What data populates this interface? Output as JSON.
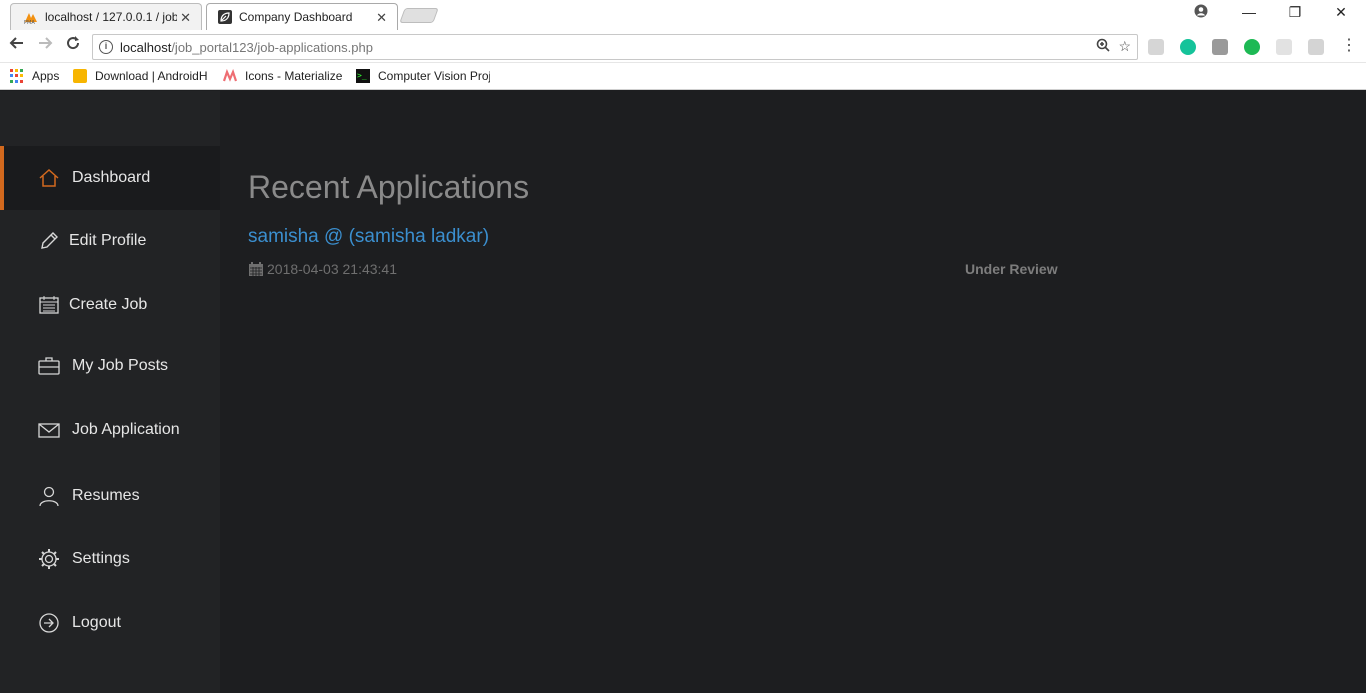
{
  "browser": {
    "tabs": [
      {
        "title": "localhost / 127.0.0.1 / job",
        "favicon": "phpmyadmin-icon"
      },
      {
        "title": "Company Dashboard",
        "favicon": "leaf-icon"
      }
    ],
    "url_host": "localhost",
    "url_path": "/job_portal123/job-applications.php",
    "bookmarks": [
      {
        "label": "Apps",
        "icon": "apps-grid-icon"
      },
      {
        "label": "Download | AndroidH",
        "icon": "android-hive-icon"
      },
      {
        "label": "Icons - Materialize",
        "icon": "materialize-icon"
      },
      {
        "label": "Computer Vision Proj",
        "icon": "terminal-icon"
      }
    ]
  },
  "sidebar": {
    "items": [
      {
        "label": "Dashboard",
        "icon": "home-icon",
        "active": true
      },
      {
        "label": "Edit Profile",
        "icon": "pencil-icon"
      },
      {
        "label": "Create Job",
        "icon": "calendar-icon"
      },
      {
        "label": "My Job Posts",
        "icon": "briefcase-icon"
      },
      {
        "label": "Job Application",
        "icon": "envelope-icon"
      },
      {
        "label": "Resumes",
        "icon": "user-icon"
      },
      {
        "label": "Settings",
        "icon": "gear-icon"
      },
      {
        "label": "Logout",
        "icon": "logout-icon"
      }
    ]
  },
  "main": {
    "heading": "Recent Applications",
    "applications": [
      {
        "name": "samisha @ (samisha ladkar)",
        "date": "2018-04-03 21:43:41",
        "status": "Under Review"
      }
    ]
  },
  "colors": {
    "accent": "#d2691e",
    "link": "#3b8fcf",
    "sidebar_bg": "#222325",
    "content_bg": "#1d1e20"
  }
}
